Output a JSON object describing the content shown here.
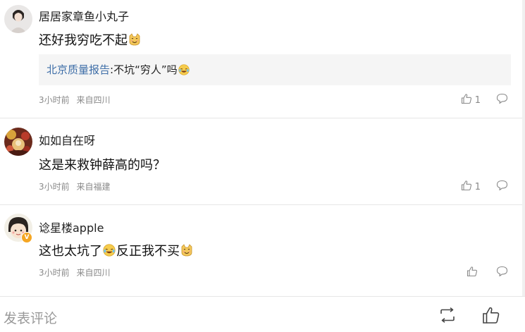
{
  "comments": [
    {
      "username": "居居家章鱼小丸子",
      "content": "还好我穷吃不起",
      "content_emoji": "cat-smile-emoji",
      "reply": {
        "user": "北京质量报告",
        "separator": ":",
        "text": "不坑“穷人”吗",
        "emoji": "laugh-cry-emoji"
      },
      "time": "3小时前",
      "location": "来自四川",
      "likes": "1"
    },
    {
      "username": "如如自在呀",
      "content": "这是来救钟薛高的吗？",
      "time": "3小时前",
      "location": "来自福建",
      "likes": "1"
    },
    {
      "username": "谂星楼apple",
      "verified_badge": "V",
      "content_part1": "这也太坑了",
      "content_emoji1": "laugh-cry-emoji",
      "content_part2": "反正我不买",
      "content_emoji2": "cat-smile-emoji",
      "time": "3小时前",
      "location": "来自四川",
      "likes": ""
    }
  ],
  "footer": {
    "input_placeholder": "发表评论",
    "repost_icon": "repost-icon",
    "like_icon": "thumbs-up-icon"
  },
  "colors": {
    "link": "#3e6ea8",
    "meta": "#8a8a8a",
    "reply_bg": "#f5f5f5",
    "badge": "#f5a623"
  }
}
